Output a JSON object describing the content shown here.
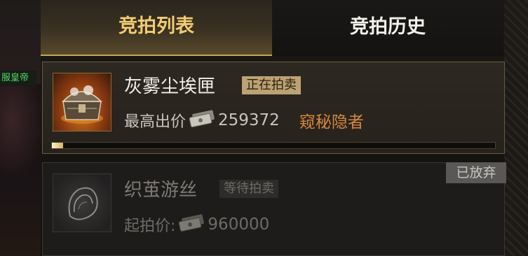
{
  "left_panel": {
    "label": "服皇帝"
  },
  "tabs": [
    {
      "label": "竞拍列表",
      "active": true
    },
    {
      "label": "竞拍历史",
      "active": false
    }
  ],
  "auctions": [
    {
      "item_name": "灰雾尘埃匣",
      "status": "正在拍卖",
      "price_label": "最高出价",
      "currency_icon": "banknote-icon",
      "price": "259372",
      "bidder": "窥秘隐者",
      "progress_fraction": 0.025
    },
    {
      "item_name": "织茧游丝",
      "status": "等待拍卖",
      "price_label": "起拍价:",
      "currency_icon": "banknote-icon",
      "price": "960000",
      "tag": "已放弃"
    }
  ],
  "colors": {
    "active_tab_text": "#f2cc72",
    "bidder_text": "#d8873a",
    "status_badge_active": "#bda373"
  }
}
